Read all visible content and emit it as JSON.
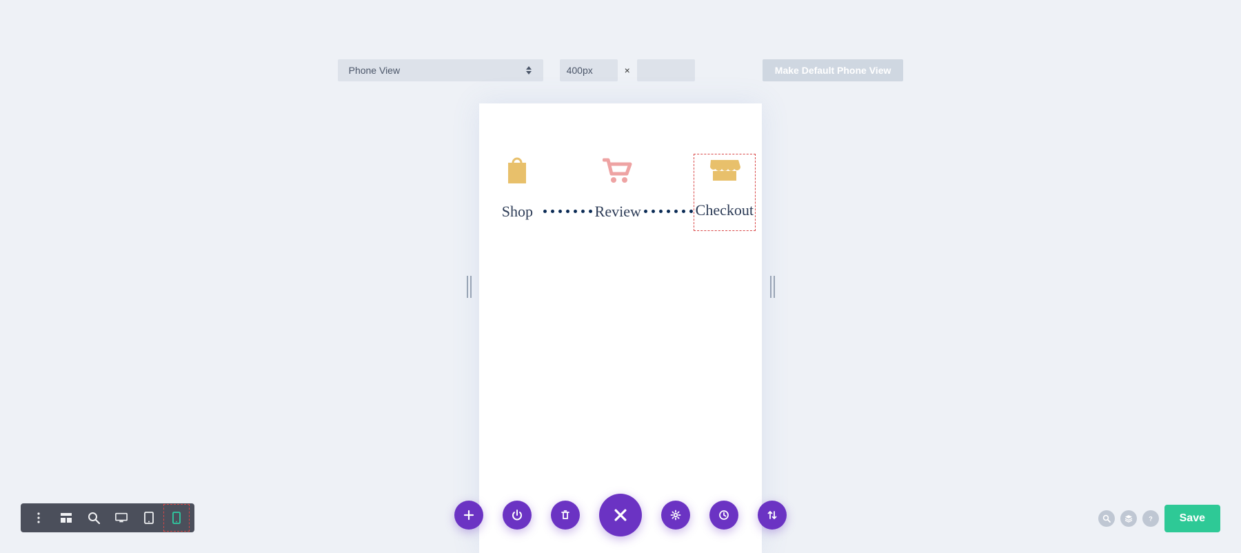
{
  "top": {
    "view_label": "Phone View",
    "width_value": "400px",
    "x_symbol": "×",
    "height_value": "",
    "make_default_label": "Make Default Phone View"
  },
  "preview": {
    "steps": [
      {
        "icon": "shopping-bag-icon",
        "label": "Shop",
        "selected": false
      },
      {
        "icon": "cart-icon",
        "label": "Review",
        "selected": false
      },
      {
        "icon": "storefront-icon",
        "label": "Checkout",
        "selected": true
      }
    ]
  },
  "bottom_left": {
    "items": [
      {
        "name": "more-icon",
        "active": false
      },
      {
        "name": "wireframe-icon",
        "active": false
      },
      {
        "name": "zoom-icon",
        "active": false
      },
      {
        "name": "desktop-icon",
        "active": false
      },
      {
        "name": "tablet-icon",
        "active": false
      },
      {
        "name": "phone-icon",
        "active": true
      }
    ]
  },
  "bottom_center": {
    "items": [
      {
        "name": "add-icon"
      },
      {
        "name": "power-icon"
      },
      {
        "name": "trash-icon"
      },
      {
        "name": "close-icon",
        "big": true
      },
      {
        "name": "gear-icon"
      },
      {
        "name": "clock-icon"
      },
      {
        "name": "sort-icon"
      }
    ]
  },
  "bottom_right": {
    "circles": [
      {
        "name": "search-icon"
      },
      {
        "name": "layers-icon"
      },
      {
        "name": "help-icon"
      }
    ],
    "save_label": "Save"
  },
  "colors": {
    "accent_purple": "#6b33c3",
    "accent_green": "#2ec996",
    "icon_sand": "#e8c06b",
    "icon_pink": "#eea3a3",
    "selection_red": "#d94646"
  }
}
